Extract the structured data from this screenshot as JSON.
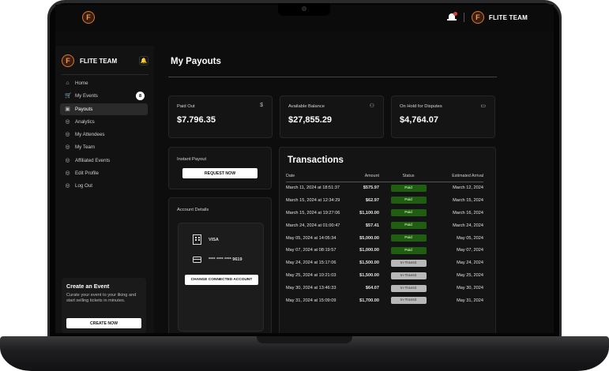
{
  "team_name": "FLITE TEAM",
  "sidebar": {
    "team_name": "FLITE TEAM",
    "items": [
      {
        "label": "Home",
        "icon": "home-icon",
        "glyph": "⌂"
      },
      {
        "label": "My Events",
        "icon": "cart-icon",
        "glyph": "🛒",
        "badge": "8"
      },
      {
        "label": "Payouts",
        "icon": "payouts-icon",
        "glyph": "▣",
        "active": true
      },
      {
        "label": "Analytics",
        "icon": "analytics-icon",
        "glyph": "◎"
      },
      {
        "label": "My Attendees",
        "icon": "attendees-icon",
        "glyph": "◎"
      },
      {
        "label": "My Team",
        "icon": "team-icon",
        "glyph": "◎"
      },
      {
        "label": "Affiliated Events",
        "icon": "affiliate-icon",
        "glyph": "◎"
      },
      {
        "label": "Edit Profile",
        "icon": "profile-icon",
        "glyph": "◎"
      },
      {
        "label": "Log Out",
        "icon": "logout-icon",
        "glyph": "◎"
      }
    ],
    "create_card": {
      "title": "Create an Event",
      "description": "Curate your event to your liking and start selling tickets in minutes.",
      "button": "CREATE NOW"
    }
  },
  "main": {
    "title": "My Payouts",
    "stats": [
      {
        "label": "Paid Out",
        "value": "$7.796.35",
        "icon": "dollar-icon",
        "glyph": "$"
      },
      {
        "label": "Available Balance",
        "value": "$27,855.29",
        "icon": "users-icon",
        "glyph": "⚇"
      },
      {
        "label": "On Hold for Disputes",
        "value": "$4,764.07",
        "icon": "card-icon",
        "glyph": "▭"
      }
    ],
    "instant_payout": {
      "label": "Instant Payout",
      "button": "REQUEST NOW"
    },
    "account": {
      "label": "Account Details",
      "bank": "VISA",
      "card_number": "**** **** **** 9619",
      "button": "CHANGE CONNECTED ACCOUNT"
    },
    "transactions": {
      "title": "Transactions",
      "headers": [
        "Date",
        "Amount",
        "Status",
        "Estimated Arrival"
      ],
      "rows": [
        {
          "date": "March 11, 2024 at 18:51:37",
          "amount": "$575.97",
          "status": "Paid",
          "arrival": "March 12, 2024"
        },
        {
          "date": "March 15, 2024 at 12:34:29",
          "amount": "$62.97",
          "status": "Paid",
          "arrival": "March 15, 2024"
        },
        {
          "date": "March 15, 2024 at 19:27:06",
          "amount": "$1,100.00",
          "status": "Paid",
          "arrival": "March 16, 2024"
        },
        {
          "date": "March 24, 2024 at 01:00:47",
          "amount": "$57.41",
          "status": "Paid",
          "arrival": "March 24, 2024"
        },
        {
          "date": "May 05, 2024 at 14:05:34",
          "amount": "$5,000.00",
          "status": "Paid",
          "arrival": "May 05, 2024"
        },
        {
          "date": "May 07, 2024 at 08:19:57",
          "amount": "$1,000.00",
          "status": "Paid",
          "arrival": "May 07, 2024"
        },
        {
          "date": "May 24, 2024 at 15:17:06",
          "amount": "$1,500.00",
          "status": "In-Transit",
          "arrival": "May 24, 2024"
        },
        {
          "date": "May 25, 2024 at 10:21:03",
          "amount": "$1,500.00",
          "status": "In-Transit",
          "arrival": "May 25, 2024"
        },
        {
          "date": "May 30, 2024 at 13:46:33",
          "amount": "$64.07",
          "status": "In-Transit",
          "arrival": "May 30, 2024"
        },
        {
          "date": "May 31, 2024 at 15:09:09",
          "amount": "$1,700.00",
          "status": "In-Transit",
          "arrival": "May 31, 2024"
        }
      ]
    }
  },
  "colors": {
    "paid": "#1f5e10",
    "in_transit": "#b8b8b8",
    "accent": "#d9772e"
  }
}
